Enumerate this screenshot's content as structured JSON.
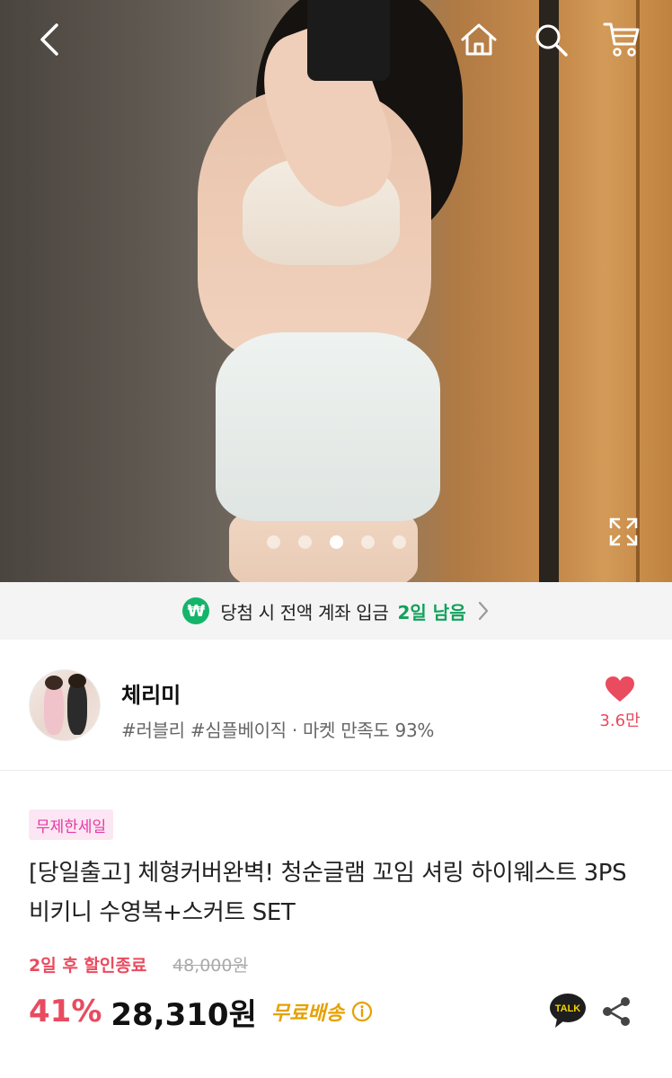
{
  "hero": {
    "image_alt": "",
    "slide_count": 5,
    "active_slide": 3,
    "icons": {
      "back": "chevron-left-icon",
      "home": "home-icon",
      "search": "search-icon",
      "cart": "cart-icon",
      "expand": "expand-icon"
    }
  },
  "notice": {
    "icon": "won-icon",
    "badge_symbol": "₩",
    "text": "당첨 시 전액 계좌 입금",
    "remaining": "2일 남음"
  },
  "seller": {
    "name": "체리미",
    "subtitle": "#러블리 #심플베이직 · 마켓 만족도 93%",
    "likes": "3.6만"
  },
  "product": {
    "badge": "무제한세일",
    "title": "[당일출고] 체형커버완벽! 청순글램 꼬임 셔링 하이웨스트 3PS 비키니 수영복+스커트 SET",
    "discount_end": "2일 후 할인종료",
    "original_price": "48,000원",
    "discount_rate": "41%",
    "price": "28,310원",
    "shipping": "무료배송"
  },
  "colors": {
    "accent_red": "#e94b5f",
    "green": "#14b56a",
    "badge_pink": "#e23aa4",
    "shipping_yellow": "#e6a100"
  }
}
